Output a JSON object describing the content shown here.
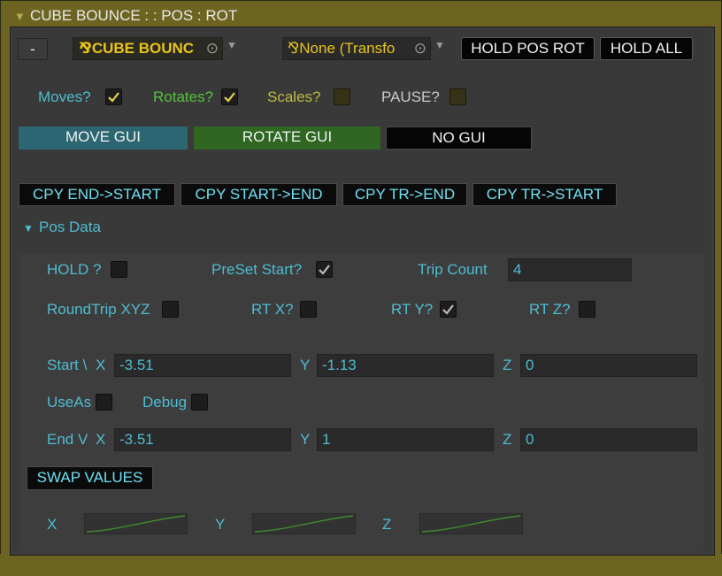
{
  "header": {
    "title": "CUBE BOUNCE :   : POS : ROT"
  },
  "toolbar": {
    "minus_label": "-",
    "target_object": "CUBE BOUNC",
    "transform_field": "None (Transfo",
    "hold_pos_rot_label": "HOLD POS ROT",
    "hold_all_label": "HOLD ALL"
  },
  "toggles": [
    {
      "label": "Moves?",
      "checked": true,
      "color": "#4ebcd2"
    },
    {
      "label": "Rotates?",
      "checked": true,
      "color": "#55c23a"
    },
    {
      "label": "Scales?",
      "checked": false,
      "color": "#bfbb3e"
    },
    {
      "label": "PAUSE?",
      "checked": false,
      "color": "#c9c9c9"
    }
  ],
  "gui_buttons": [
    {
      "label": "MOVE GUI",
      "color": "#2d6673"
    },
    {
      "label": "ROTATE GUI",
      "color": "#2e6622"
    },
    {
      "label": "NO GUI",
      "color": "#050505"
    }
  ],
  "copy_buttons": [
    "CPY END->START",
    "CPY START->END",
    "CPY TR->END",
    "CPY TR->START"
  ],
  "pos_data": {
    "foldout_label": "Pos Data",
    "hold_label": "HOLD ?",
    "hold_checked": false,
    "preset_start_label": "PreSet Start?",
    "preset_start_checked": true,
    "trip_count_label": "Trip Count",
    "trip_count_value": "4",
    "roundtrip_label": "RoundTrip XYZ",
    "roundtrip_checked": false,
    "rtx_label": "RT X?",
    "rtx_checked": false,
    "rty_label": "RT Y?",
    "rty_checked": true,
    "rtz_label": "RT Z?",
    "rtz_checked": false,
    "start_label": "Start \\",
    "start": {
      "x_label": "X",
      "x": "-3.51",
      "y_label": "Y",
      "y": "-1.13",
      "z_label": "Z",
      "z": "0"
    },
    "useas_label": "UseAs",
    "useas_checked": false,
    "debug_label": "Debug",
    "debug_checked": false,
    "end_label": "End V",
    "end": {
      "x_label": "X",
      "x": "-3.51",
      "y_label": "Y",
      "y": "1",
      "z_label": "Z",
      "z": "0"
    },
    "swap_label": "SWAP VALUES",
    "curves": [
      {
        "label": "X",
        "icon": "ease-curve-icon"
      },
      {
        "label": "Y",
        "icon": "ease-curve-icon"
      },
      {
        "label": "Z",
        "icon": "ease-curve-icon"
      }
    ]
  },
  "colors": {
    "accent_teal": "#4ebcd2",
    "accent_green": "#55c23a",
    "accent_olive": "#bfbb3e",
    "frame_olive": "#6e6422",
    "check_yellow": "#e8d44a"
  }
}
